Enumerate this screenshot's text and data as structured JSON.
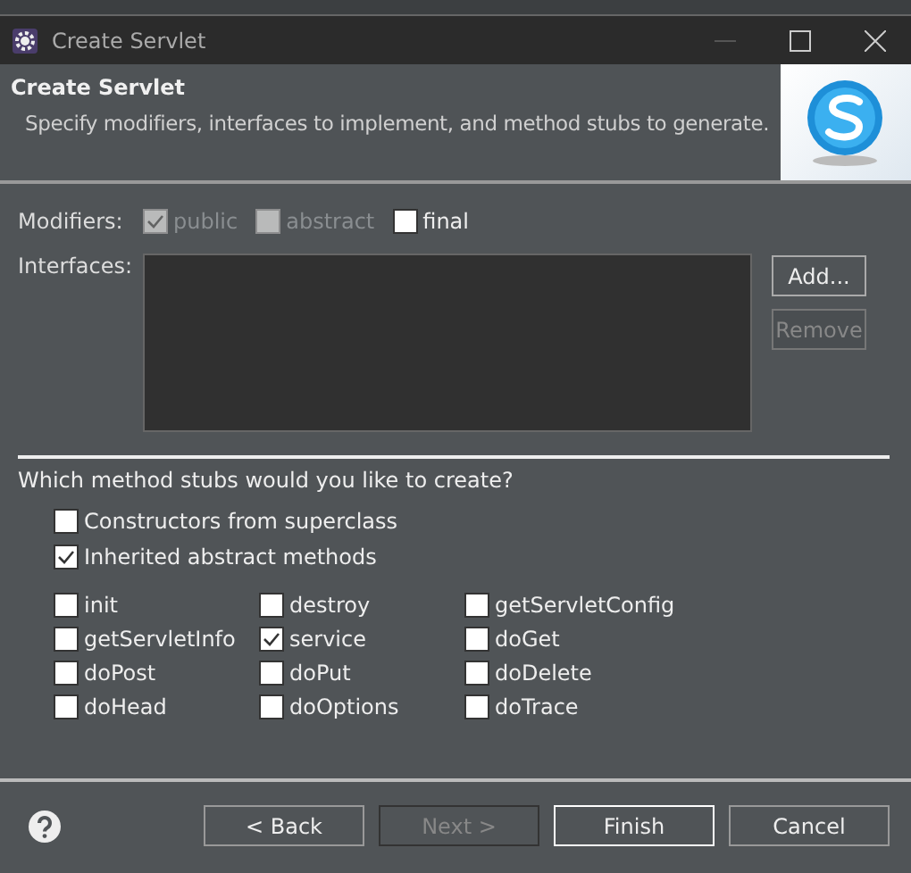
{
  "window": {
    "title": "Create Servlet"
  },
  "header": {
    "title": "Create Servlet",
    "description": "Specify modifiers, interfaces to implement, and method stubs to generate."
  },
  "modifiers": {
    "label": "Modifiers:",
    "options": [
      {
        "label": "public",
        "checked": true,
        "disabled": true
      },
      {
        "label": "abstract",
        "checked": false,
        "disabled": true
      },
      {
        "label": "final",
        "checked": false,
        "disabled": false
      }
    ]
  },
  "interfaces": {
    "label": "Interfaces:",
    "buttons": [
      {
        "label": "Add...",
        "disabled": false
      },
      {
        "label": "Remove",
        "disabled": true
      }
    ]
  },
  "stubs": {
    "question": "Which method stubs would you like to create?",
    "general": [
      {
        "label": "Constructors from superclass",
        "checked": false
      },
      {
        "label": "Inherited abstract methods",
        "checked": true
      }
    ],
    "methods": [
      {
        "label": "init",
        "checked": false
      },
      {
        "label": "destroy",
        "checked": false
      },
      {
        "label": "getServletConfig",
        "checked": false
      },
      {
        "label": "getServletInfo",
        "checked": false
      },
      {
        "label": "service",
        "checked": true
      },
      {
        "label": "doGet",
        "checked": false
      },
      {
        "label": "doPost",
        "checked": false
      },
      {
        "label": "doPut",
        "checked": false
      },
      {
        "label": "doDelete",
        "checked": false
      },
      {
        "label": "doHead",
        "checked": false
      },
      {
        "label": "doOptions",
        "checked": false
      },
      {
        "label": "doTrace",
        "checked": false
      }
    ]
  },
  "buttons": [
    {
      "label": "< Back",
      "disabled": false,
      "default": false
    },
    {
      "label": "Next >",
      "disabled": true,
      "default": false
    },
    {
      "label": "Finish",
      "disabled": false,
      "default": true
    },
    {
      "label": "Cancel",
      "disabled": false,
      "default": false
    }
  ]
}
